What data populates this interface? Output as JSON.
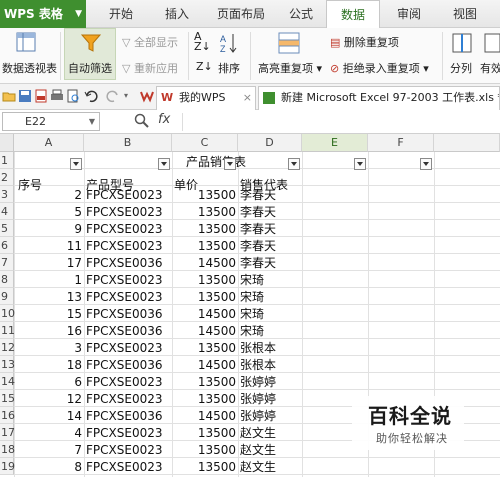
{
  "app": {
    "menu_button": "WPS 表格",
    "tabs": [
      "开始",
      "插入",
      "页面布局",
      "公式",
      "数据",
      "审阅",
      "视图"
    ],
    "active_tab": "数据"
  },
  "ribbon": {
    "pivot": "数据透视表",
    "auto_filter": "自动筛选",
    "show_all": "全部显示",
    "reapply": "重新应用",
    "sort": "排序",
    "highlight_dup": "高亮重复项",
    "delete_dup": "删除重复项",
    "reject_dup": "拒绝录入重复项",
    "split_col": "分列",
    "valid": "有效"
  },
  "doc_tabs": {
    "home": "我的WPS",
    "file": "新建 Microsoft Excel 97-2003 工作表.xls *"
  },
  "formula_bar": {
    "cell_ref": "E22",
    "fx": "fx",
    "content": ""
  },
  "sheet": {
    "columns": [
      "A",
      "B",
      "C",
      "D",
      "E",
      "F"
    ],
    "selected_column": "E",
    "title": "产品销售表",
    "headers": [
      "序号",
      "产品型号",
      "单价",
      "销售代表"
    ],
    "rows": [
      {
        "n": "2",
        "model": "FPCXSE0023",
        "price": "13500",
        "rep": "李春天"
      },
      {
        "n": "5",
        "model": "FPCXSE0023",
        "price": "13500",
        "rep": "李春天"
      },
      {
        "n": "9",
        "model": "FPCXSE0023",
        "price": "13500",
        "rep": "李春天"
      },
      {
        "n": "11",
        "model": "FPCXSE0023",
        "price": "13500",
        "rep": "李春天"
      },
      {
        "n": "17",
        "model": "FPCXSE0036",
        "price": "14500",
        "rep": "李春天"
      },
      {
        "n": "1",
        "model": "FPCXSE0023",
        "price": "13500",
        "rep": "宋琦"
      },
      {
        "n": "13",
        "model": "FPCXSE0023",
        "price": "13500",
        "rep": "宋琦"
      },
      {
        "n": "15",
        "model": "FPCXSE0036",
        "price": "14500",
        "rep": "宋琦"
      },
      {
        "n": "16",
        "model": "FPCXSE0036",
        "price": "14500",
        "rep": "宋琦"
      },
      {
        "n": "3",
        "model": "FPCXSE0023",
        "price": "13500",
        "rep": "张根本"
      },
      {
        "n": "18",
        "model": "FPCXSE0036",
        "price": "14500",
        "rep": "张根本"
      },
      {
        "n": "6",
        "model": "FPCXSE0023",
        "price": "13500",
        "rep": "张婷婷"
      },
      {
        "n": "12",
        "model": "FPCXSE0023",
        "price": "13500",
        "rep": "张婷婷"
      },
      {
        "n": "14",
        "model": "FPCXSE0036",
        "price": "14500",
        "rep": "张婷婷"
      },
      {
        "n": "4",
        "model": "FPCXSE0023",
        "price": "13500",
        "rep": "赵文生"
      },
      {
        "n": "7",
        "model": "FPCXSE0023",
        "price": "13500",
        "rep": "赵文生"
      },
      {
        "n": "8",
        "model": "FPCXSE0023",
        "price": "13500",
        "rep": "赵文生"
      }
    ]
  },
  "watermark": {
    "title": "百科全说",
    "subtitle": "助你轻松解决"
  },
  "colors": {
    "wps_green": "#3f8f2f",
    "selected_col": "#e3ecd6"
  }
}
